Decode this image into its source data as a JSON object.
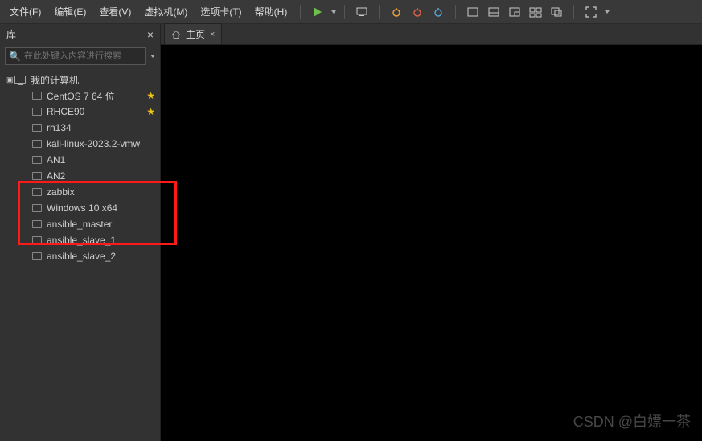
{
  "menu": {
    "file": "文件(F)",
    "edit": "编辑(E)",
    "view": "查看(V)",
    "vm": "虚拟机(M)",
    "tabs": "选项卡(T)",
    "help": "帮助(H)"
  },
  "sidebar": {
    "title": "库",
    "search_placeholder": "在此处键入内容进行搜索",
    "root": "我的计算机",
    "items": [
      {
        "label": "CentOS 7 64 位",
        "star": true
      },
      {
        "label": "RHCE90",
        "star": true
      },
      {
        "label": "rh134",
        "star": false
      },
      {
        "label": "kali-linux-2023.2-vmw",
        "star": false
      },
      {
        "label": "AN1",
        "star": false
      },
      {
        "label": "AN2",
        "star": false
      },
      {
        "label": "zabbix",
        "star": false
      },
      {
        "label": "Windows 10 x64",
        "star": false
      },
      {
        "label": "ansible_master",
        "star": false
      },
      {
        "label": "ansible_slave_1",
        "star": false
      },
      {
        "label": "ansible_slave_2",
        "star": false
      }
    ]
  },
  "tabs": {
    "home": "主页"
  },
  "watermark": "CSDN @白嫖一茶"
}
